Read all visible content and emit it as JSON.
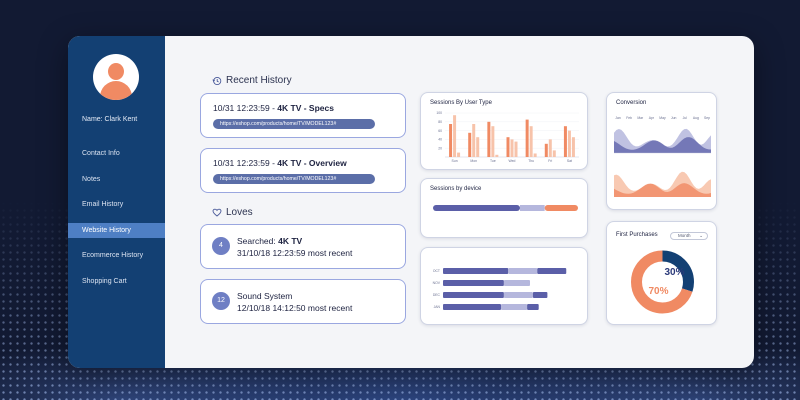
{
  "user": {
    "name_label": "Name: Clark Kent"
  },
  "sidebar": {
    "items": [
      {
        "label": "Contact Info",
        "active": false
      },
      {
        "label": "Notes",
        "active": false
      },
      {
        "label": "Email History",
        "active": false
      },
      {
        "label": "Website History",
        "active": true
      },
      {
        "label": "Ecommerce History",
        "active": false
      },
      {
        "label": "Shopping Cart",
        "active": false
      }
    ]
  },
  "recent_history": {
    "title": "Recent History",
    "items": [
      {
        "time": "10/31 12:23:59 - ",
        "page": "4K TV - Specs",
        "url": "https://eshop.com/products/home/TV/MODEL123#"
      },
      {
        "time": "10/31 12:23:59 - ",
        "page": "4K TV - Overview",
        "url": "https://eshop.com/products/home/TV/MODEL123#"
      }
    ]
  },
  "loves": {
    "title": "Loves",
    "items": [
      {
        "count": "4",
        "prefix": "Searched: ",
        "term": "4K TV",
        "detail": "31/10/18 12:23:59 most recent"
      },
      {
        "count": "12",
        "prefix": "",
        "term": "Sound System",
        "detail": "12/10/18 14:12:50 most recent"
      }
    ]
  },
  "colors": {
    "navy": "#134073",
    "accent": "#4e7fc4",
    "orange": "#f08a63",
    "light_orange": "#f7c3aa",
    "purple": "#5b5fa8",
    "light_purple": "#b5b7dd"
  },
  "chart_data": [
    {
      "type": "bar",
      "title": "Sessions By User Type",
      "categories": [
        "Sun",
        "Mon",
        "Tue",
        "Wed",
        "Thu",
        "Fri",
        "Sat"
      ],
      "yticks": [
        "100",
        "80",
        "60",
        "40",
        "20"
      ],
      "ylim": [
        0,
        100
      ],
      "series": [
        {
          "values": [
            75,
            55,
            80,
            45,
            85,
            30,
            70
          ]
        },
        {
          "values": [
            95,
            75,
            70,
            40,
            70,
            40,
            60
          ]
        },
        {
          "values": [
            10,
            45,
            5,
            35,
            8,
            15,
            45
          ]
        }
      ]
    },
    {
      "type": "bar",
      "title": "Sessions by device",
      "series": [
        {
          "values": [
            60
          ]
        },
        {
          "values": [
            17
          ]
        },
        {
          "values": [
            23
          ]
        }
      ]
    },
    {
      "type": "bar",
      "categories": [
        "OCT",
        "NOV",
        "DEC",
        "JAN"
      ],
      "series": [
        {
          "values": [
            45,
            42,
            42,
            40
          ]
        },
        {
          "values": [
            20,
            18,
            20,
            18
          ]
        },
        {
          "values": [
            20,
            0,
            10,
            8
          ]
        }
      ]
    },
    {
      "type": "area",
      "title": "Conversion",
      "categories": [
        "Jan",
        "Feb",
        "Mar",
        "Apr",
        "May",
        "Jun",
        "Jul",
        "Aug",
        "Sep"
      ]
    },
    {
      "type": "pie",
      "title": "First Purchases",
      "filter": "Month",
      "slices": [
        {
          "label": "30%",
          "value": 30
        },
        {
          "label": "70%",
          "value": 70
        }
      ]
    }
  ]
}
